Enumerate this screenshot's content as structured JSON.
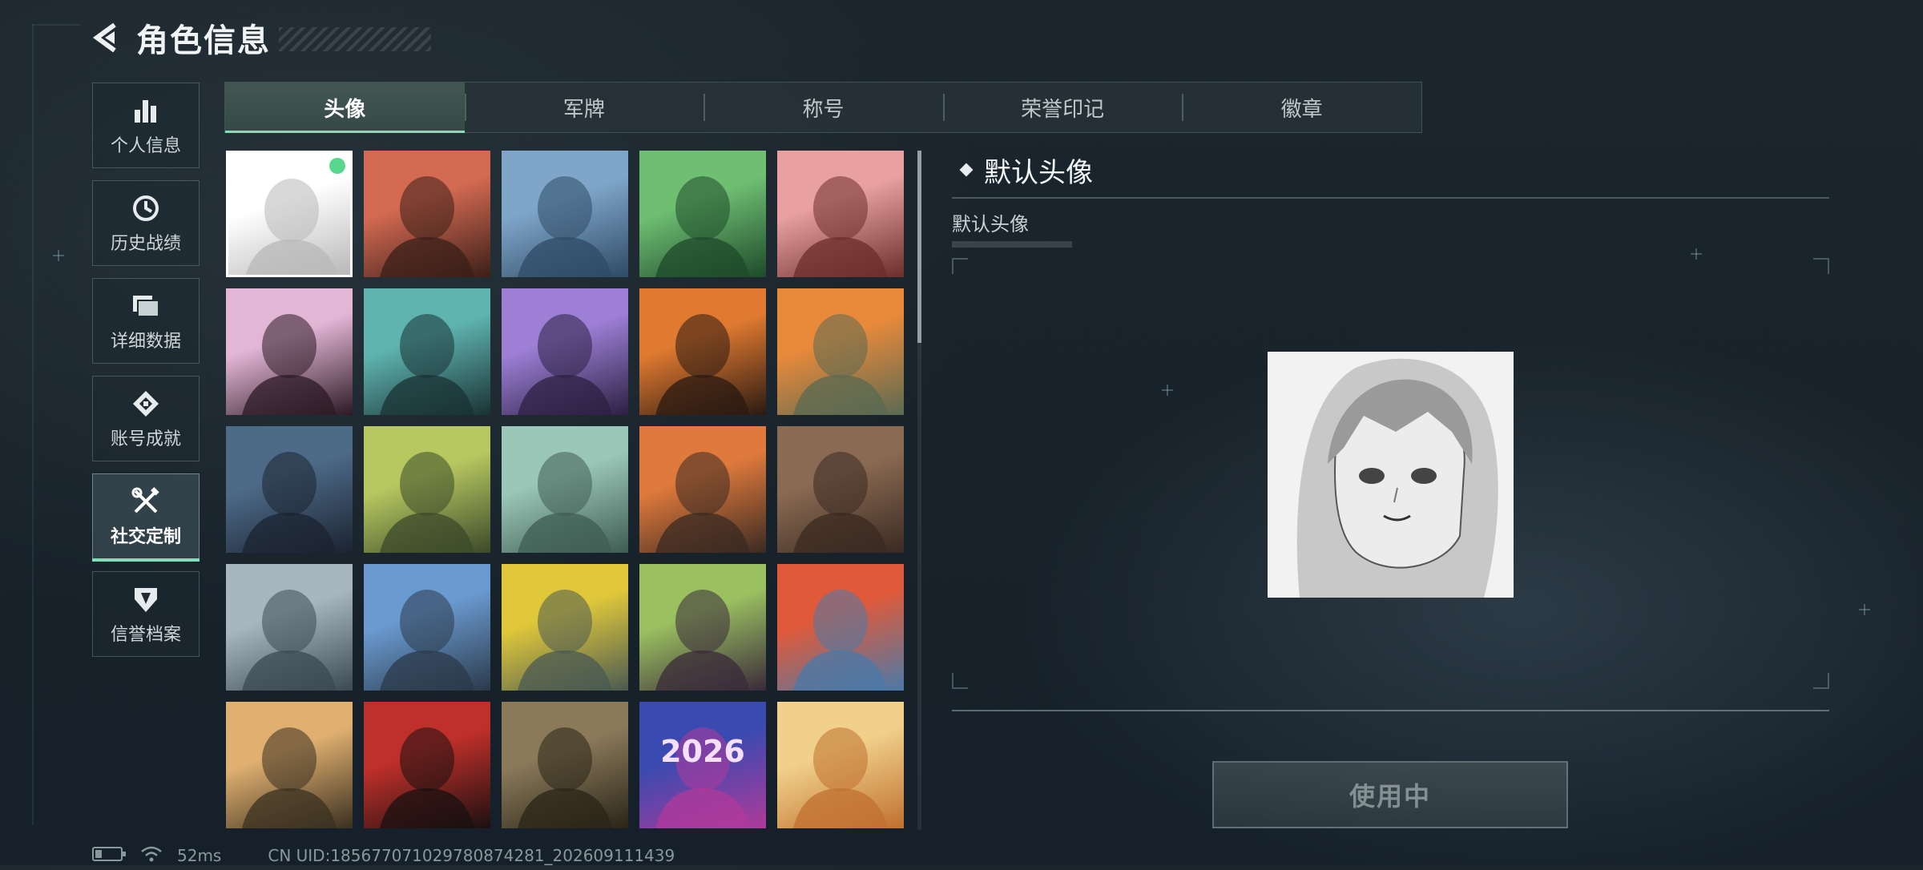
{
  "header": {
    "title": "角色信息"
  },
  "sidebar": {
    "items": [
      {
        "label": "个人信息",
        "icon": "bar-chart-icon"
      },
      {
        "label": "历史战绩",
        "icon": "clock-icon"
      },
      {
        "label": "详细数据",
        "icon": "folder-icon"
      },
      {
        "label": "账号成就",
        "icon": "achievement-icon"
      },
      {
        "label": "社交定制",
        "icon": "tools-icon",
        "active": true
      },
      {
        "label": "信誉档案",
        "icon": "reputation-icon"
      }
    ]
  },
  "tabs": [
    {
      "label": "头像",
      "active": true
    },
    {
      "label": "军牌"
    },
    {
      "label": "称号"
    },
    {
      "label": "荣誉印记"
    },
    {
      "label": "徽章"
    }
  ],
  "avatars": [
    {
      "name": "default-avatar",
      "colors": [
        "#ffffff",
        "#b8b8b8"
      ],
      "selected": true,
      "equipped": true
    },
    {
      "name": "soldier-cap-avatar",
      "colors": [
        "#d46a52",
        "#3a1f18"
      ]
    },
    {
      "name": "pilot-avatar",
      "colors": [
        "#7fa6c9",
        "#2e4a66"
      ]
    },
    {
      "name": "headset-man-avatar",
      "colors": [
        "#6fbf73",
        "#1e4a2a"
      ]
    },
    {
      "name": "helmet-soldier-avatar",
      "colors": [
        "#e8a0a0",
        "#6b2e2a"
      ]
    },
    {
      "name": "pink-hair-avatar",
      "colors": [
        "#e3b6d6",
        "#2b1a24"
      ]
    },
    {
      "name": "bearded-man-avatar",
      "colors": [
        "#5fb4b0",
        "#1a3234"
      ]
    },
    {
      "name": "purple-girl-avatar",
      "colors": [
        "#9d7fd6",
        "#2c2042"
      ]
    },
    {
      "name": "masked-man-avatar",
      "colors": [
        "#e07a30",
        "#2a1a12"
      ]
    },
    {
      "name": "heavy-soldier-avatar",
      "colors": [
        "#e98a3a",
        "#5a6a52"
      ]
    },
    {
      "name": "sniper-rifle-avatar",
      "colors": [
        "#4d6a88",
        "#1b2330"
      ]
    },
    {
      "name": "exit-door-avatar",
      "colors": [
        "#b8c860",
        "#3b4a2a"
      ]
    },
    {
      "name": "way-out-sign-avatar",
      "colors": [
        "#9ac7b8",
        "#3f5c52"
      ]
    },
    {
      "name": "feather-avatar",
      "colors": [
        "#e07a3c",
        "#3a2a22"
      ]
    },
    {
      "name": "scales-emblem-avatar",
      "colors": [
        "#8a6a52",
        "#3a2a22"
      ]
    },
    {
      "name": "mountain-explorer-avatar",
      "colors": [
        "#a8b6c0",
        "#3b4a52"
      ]
    },
    {
      "name": "archer-avatar",
      "colors": [
        "#6a9ad0",
        "#2b3a4a"
      ]
    },
    {
      "name": "alligator-sign-avatar",
      "colors": [
        "#e0c83a",
        "#4a5a52"
      ]
    },
    {
      "name": "zombie-reader-avatar",
      "colors": [
        "#9ac060",
        "#3a2a3a"
      ]
    },
    {
      "name": "monkey-reader-avatar",
      "colors": [
        "#e05a3a",
        "#4a7aa8"
      ]
    },
    {
      "name": "pyramid-selfie-avatar",
      "colors": [
        "#e0b070",
        "#3a3020"
      ]
    },
    {
      "name": "red-mask-avatar",
      "colors": [
        "#c0302a",
        "#1a1010"
      ]
    },
    {
      "name": "armored-soldier-avatar",
      "colors": [
        "#8a7a5a",
        "#2a2418"
      ]
    },
    {
      "name": "fireworks-2026-avatar",
      "colors": [
        "#3a4ab0",
        "#b03a9a"
      ],
      "text": "2026"
    },
    {
      "name": "hotpot-avatar",
      "colors": [
        "#f0d08a",
        "#c07030"
      ]
    }
  ],
  "detail": {
    "title": "默认头像",
    "subtitle": "默认头像",
    "button_label": "使用中"
  },
  "status": {
    "ping": "52ms",
    "uid": "CN UID:18567707102978087428​1_202609111439"
  },
  "colors": {
    "accent": "#7ee0b6",
    "background": "#18222a"
  }
}
